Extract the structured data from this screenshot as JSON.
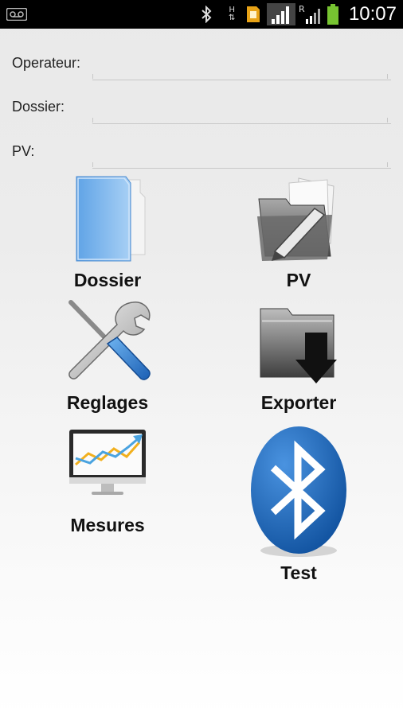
{
  "status_bar": {
    "time": "10:07",
    "signal_1_label": "H",
    "signal_2_label": "R"
  },
  "form": {
    "operateur_label": "Operateur:",
    "operateur_value": "",
    "dossier_label": "Dossier:",
    "dossier_value": "",
    "pv_label": "PV:",
    "pv_value": ""
  },
  "tiles": [
    {
      "label": "Dossier",
      "icon": "folder-icon"
    },
    {
      "label": "PV",
      "icon": "folder-edit-icon"
    },
    {
      "label": "Reglages",
      "icon": "wrench-screwdriver-icon"
    },
    {
      "label": "Exporter",
      "icon": "folder-download-icon"
    },
    {
      "label": "Mesures",
      "icon": "monitor-chart-icon"
    },
    {
      "label": "Test",
      "icon": "bluetooth-icon"
    }
  ],
  "colors": {
    "folder_blue": "#7fb6ec",
    "bluetooth_blue": "#1f6cc0",
    "battery_green": "#77c431"
  }
}
